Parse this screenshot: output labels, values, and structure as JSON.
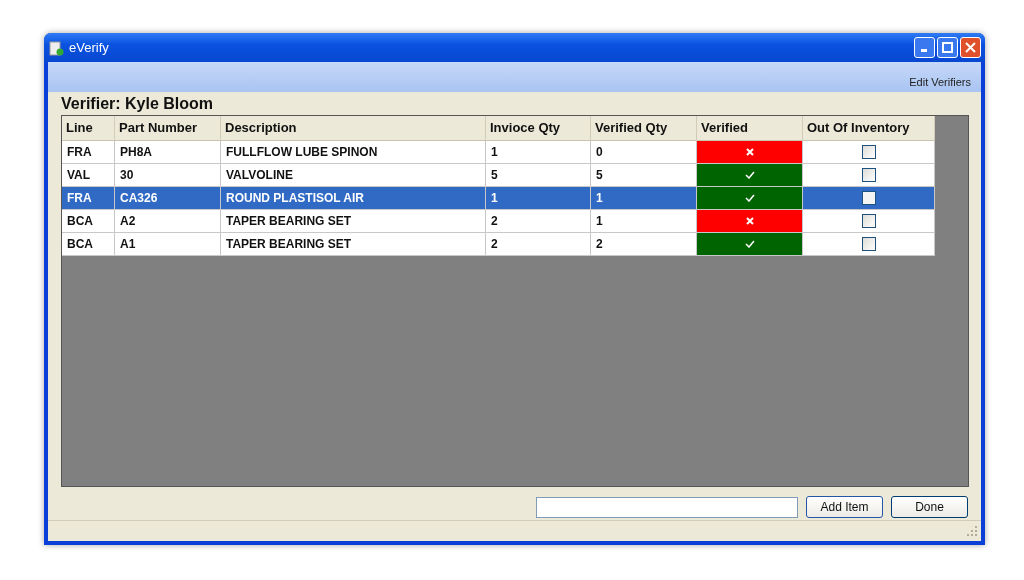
{
  "window": {
    "title": "eVerify"
  },
  "menu": {
    "items": [
      "Edit Verifiers"
    ]
  },
  "verifier_label": "Verifier: Kyle Bloom",
  "table": {
    "columns": [
      "Line",
      "Part Number",
      "Description",
      "Invioce Qty",
      "Verified Qty",
      "Verified",
      "Out Of Inventory"
    ],
    "rows": [
      {
        "line": "FRA",
        "part_number": "PH8A",
        "description": "FULLFLOW LUBE SPINON",
        "invoice_qty": "1",
        "verified_qty": "0",
        "verified": false,
        "out_of_inventory": false,
        "selected": false
      },
      {
        "line": "VAL",
        "part_number": "30",
        "description": "VALVOLINE",
        "invoice_qty": "5",
        "verified_qty": "5",
        "verified": true,
        "out_of_inventory": false,
        "selected": false
      },
      {
        "line": "FRA",
        "part_number": "CA326",
        "description": "ROUND PLASTISOL AIR",
        "invoice_qty": "1",
        "verified_qty": "1",
        "verified": true,
        "out_of_inventory": false,
        "selected": true
      },
      {
        "line": "BCA",
        "part_number": "A2",
        "description": "TAPER BEARING SET",
        "invoice_qty": "2",
        "verified_qty": "1",
        "verified": false,
        "out_of_inventory": false,
        "selected": false
      },
      {
        "line": "BCA",
        "part_number": "A1",
        "description": "TAPER BEARING SET",
        "invoice_qty": "2",
        "verified_qty": "2",
        "verified": true,
        "out_of_inventory": false,
        "selected": false
      }
    ]
  },
  "buttons": [
    "Add Item",
    "Done"
  ]
}
